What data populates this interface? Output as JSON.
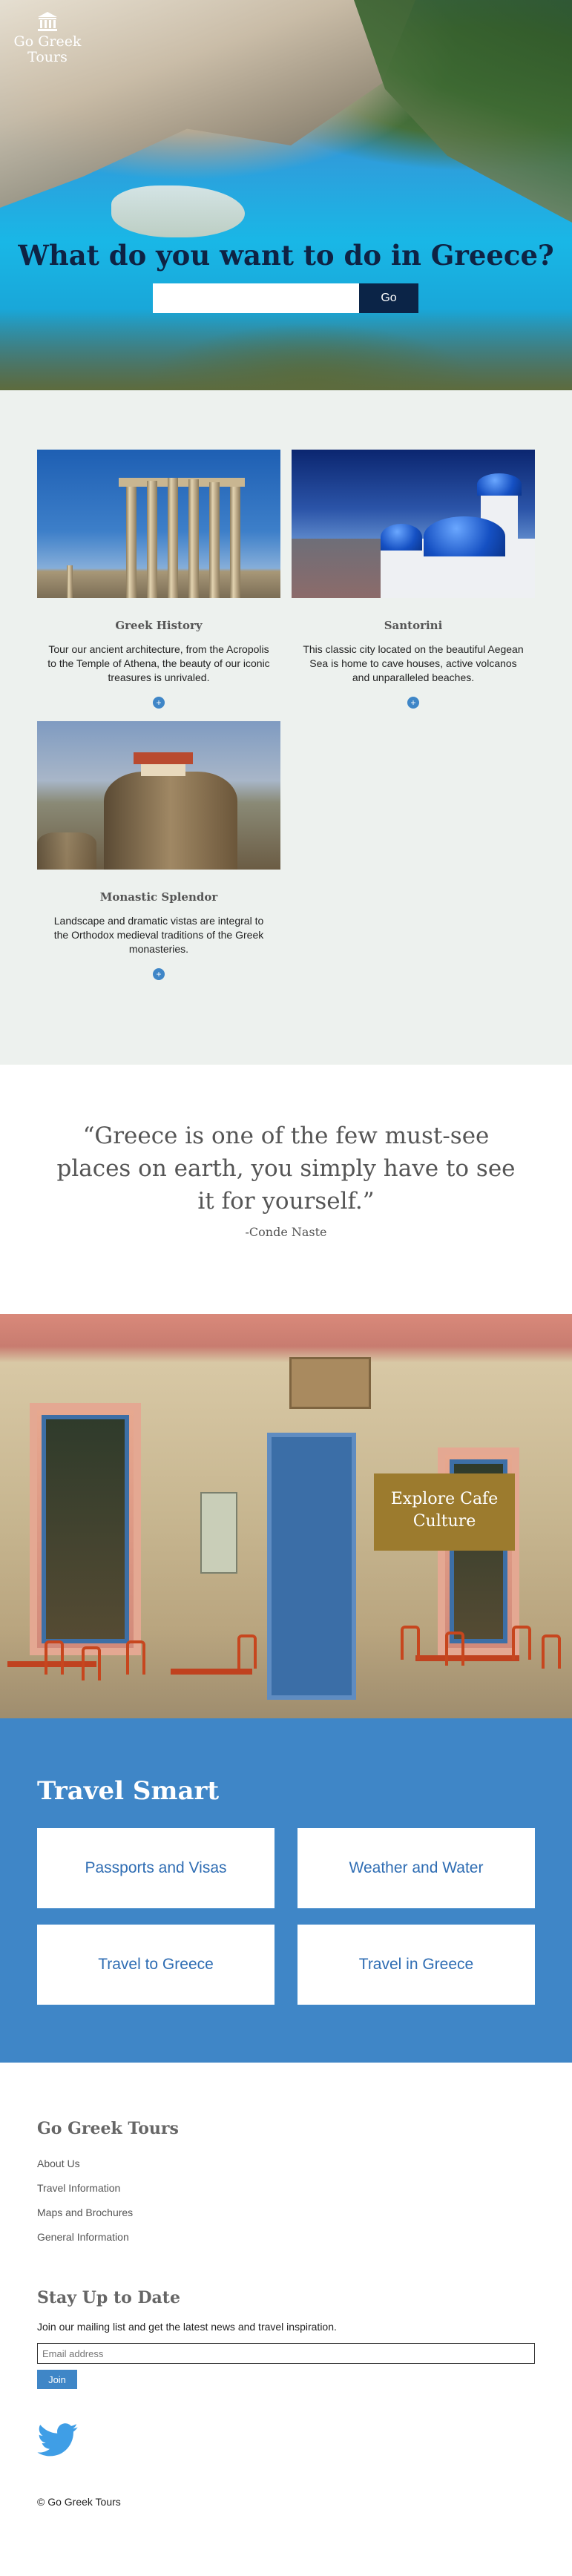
{
  "brand": {
    "line1": "Go Greek",
    "line2": "Tours"
  },
  "hero": {
    "title": "What do you want to do in Greece?",
    "search_placeholder": "",
    "search_button": "Go"
  },
  "cards": [
    {
      "title": "Greek History",
      "text": "Tour our ancient architecture, from the Acropolis to the Temple of Athena, the beauty of our iconic treasures is unrivaled.",
      "more_icon": "plus-circle-icon"
    },
    {
      "title": "Santorini",
      "text": "This classic city located on the beautiful Aegean Sea is home to cave houses, active volcanos and unparalleled beaches.",
      "more_icon": "plus-circle-icon"
    },
    {
      "title": "Monastic Splendor",
      "text": "Landscape and dramatic vistas are integral to the Orthodox medieval traditions of the Greek monasteries.",
      "more_icon": "plus-circle-icon"
    }
  ],
  "quote": {
    "text": "“Greece is one of the few must-see places on earth, you simply have to see it for yourself.”",
    "author": "-Conde Naste"
  },
  "cafe": {
    "cta": "Explore Cafe Culture"
  },
  "travel_smart": {
    "title": "Travel Smart",
    "items": [
      "Passports and Visas",
      "Weather and Water",
      "Travel to Greece",
      "Travel in Greece"
    ]
  },
  "footer": {
    "title": "Go Greek Tours",
    "links": [
      "About Us",
      "Travel Information",
      "Maps and Brochures",
      "General Information"
    ],
    "newsletter_title": "Stay Up to Date",
    "newsletter_desc": "Join our mailing list and get the latest news and travel inspiration.",
    "email_placeholder": "Email address",
    "join_button": "Join",
    "social_icon": "twitter-icon",
    "copyright": "© Go Greek Tours"
  },
  "colors": {
    "primary_blue": "#3f86c7",
    "navy": "#0b2447",
    "gold": "#9c7b2e",
    "card_bg": "#edf1ee"
  }
}
